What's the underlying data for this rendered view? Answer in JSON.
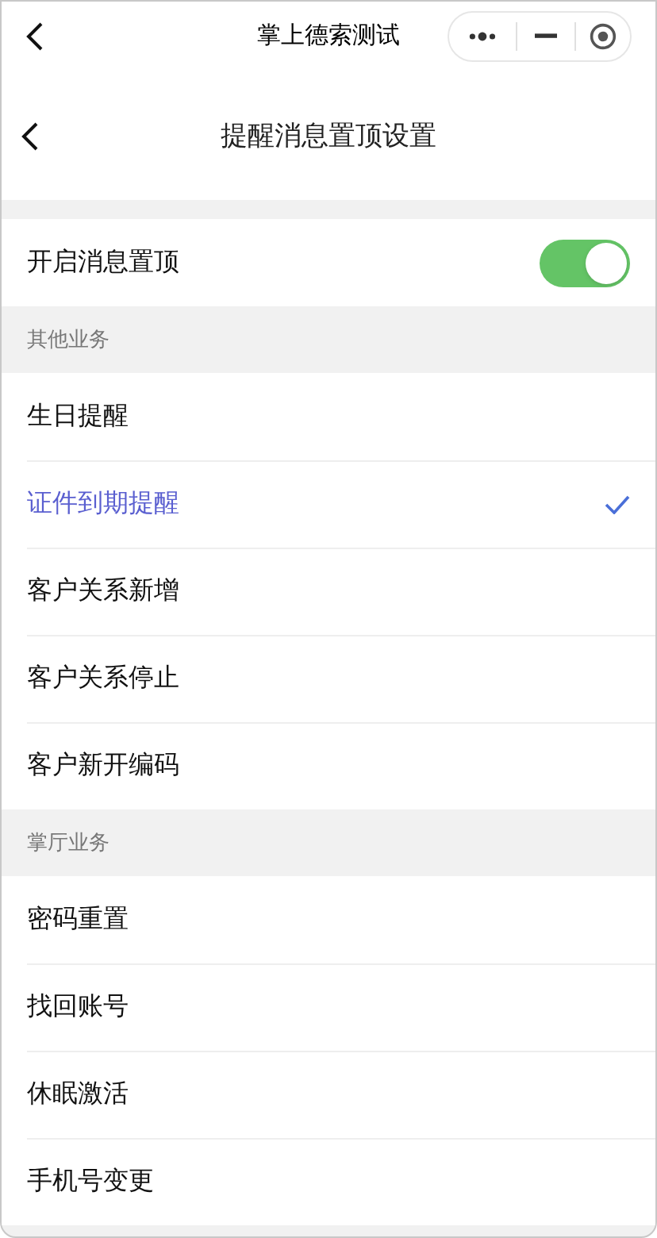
{
  "mini_program_bar": {
    "title": "掌上德索测试"
  },
  "header": {
    "title": "提醒消息置顶设置"
  },
  "pin_toggle": {
    "label": "开启消息置顶",
    "on": true
  },
  "sections": [
    {
      "title": "其他业务",
      "items": [
        {
          "label": "生日提醒",
          "selected": false
        },
        {
          "label": "证件到期提醒",
          "selected": true
        },
        {
          "label": "客户关系新增",
          "selected": false
        },
        {
          "label": "客户关系停止",
          "selected": false
        },
        {
          "label": "客户新开编码",
          "selected": false
        }
      ]
    },
    {
      "title": "掌厅业务",
      "items": [
        {
          "label": "密码重置",
          "selected": false
        },
        {
          "label": "找回账号",
          "selected": false
        },
        {
          "label": "休眠激活",
          "selected": false
        },
        {
          "label": "手机号变更",
          "selected": false
        }
      ]
    }
  ]
}
